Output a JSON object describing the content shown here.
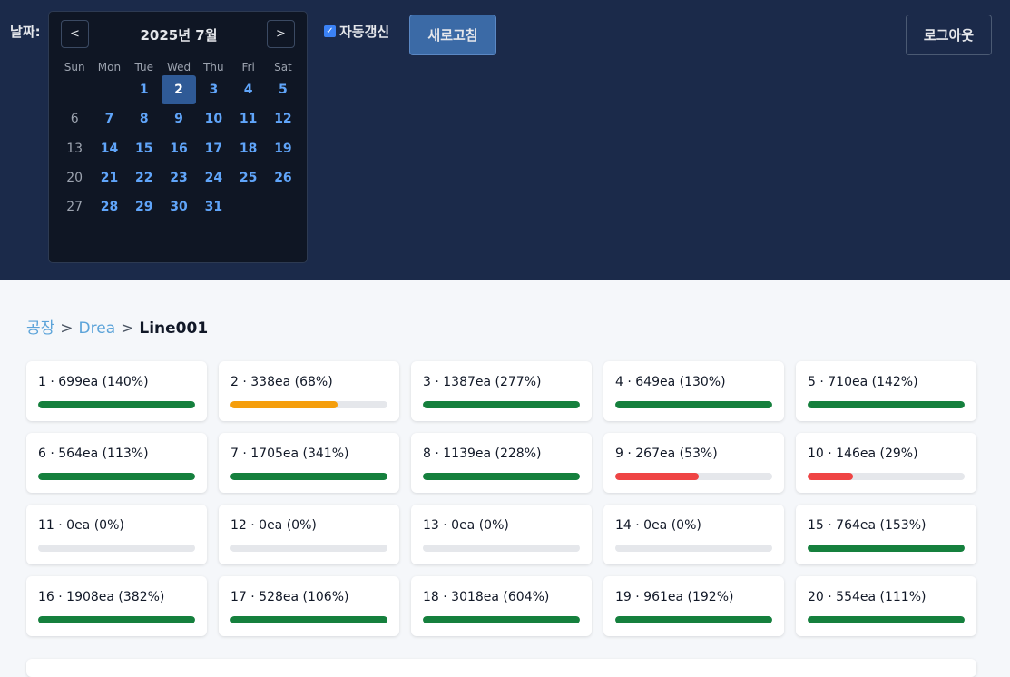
{
  "header": {
    "date_label": "날짜:",
    "auto_refresh_label": "자동갱신",
    "auto_refresh_checked": true,
    "refresh_button": "새로고침",
    "logout_button": "로그아웃"
  },
  "calendar": {
    "title": "2025년 7월",
    "prev": "<",
    "next": ">",
    "weekdays": [
      "Sun",
      "Mon",
      "Tue",
      "Wed",
      "Thu",
      "Fri",
      "Sat"
    ],
    "selected_day": "2",
    "weeks": [
      [
        "",
        "",
        "1",
        "2",
        "3",
        "4",
        "5"
      ],
      [
        "6",
        "7",
        "8",
        "9",
        "10",
        "11",
        "12"
      ],
      [
        "13",
        "14",
        "15",
        "16",
        "17",
        "18",
        "19"
      ],
      [
        "20",
        "21",
        "22",
        "23",
        "24",
        "25",
        "26"
      ],
      [
        "27",
        "28",
        "29",
        "30",
        "31",
        "",
        ""
      ]
    ]
  },
  "breadcrumb": {
    "items": [
      "공장",
      "Drea"
    ],
    "separator": ">",
    "current": "Line001"
  },
  "cards": [
    {
      "label": "1 · 699ea (140%)",
      "fill": 1.0,
      "status": "green"
    },
    {
      "label": "2 · 338ea (68%)",
      "fill": 0.68,
      "status": "orange"
    },
    {
      "label": "3 · 1387ea (277%)",
      "fill": 1.0,
      "status": "green"
    },
    {
      "label": "4 · 649ea (130%)",
      "fill": 1.0,
      "status": "green"
    },
    {
      "label": "5 · 710ea (142%)",
      "fill": 1.0,
      "status": "green"
    },
    {
      "label": "6 · 564ea (113%)",
      "fill": 1.0,
      "status": "green"
    },
    {
      "label": "7 · 1705ea (341%)",
      "fill": 1.0,
      "status": "green"
    },
    {
      "label": "8 · 1139ea (228%)",
      "fill": 1.0,
      "status": "green"
    },
    {
      "label": "9 · 267ea (53%)",
      "fill": 0.53,
      "status": "red"
    },
    {
      "label": "10 · 146ea (29%)",
      "fill": 0.29,
      "status": "red"
    },
    {
      "label": "11 · 0ea (0%)",
      "fill": 0,
      "status": "gray"
    },
    {
      "label": "12 · 0ea (0%)",
      "fill": 0,
      "status": "gray"
    },
    {
      "label": "13 · 0ea (0%)",
      "fill": 0,
      "status": "gray"
    },
    {
      "label": "14 · 0ea (0%)",
      "fill": 0,
      "status": "gray"
    },
    {
      "label": "15 · 764ea (153%)",
      "fill": 1.0,
      "status": "green"
    },
    {
      "label": "16 · 1908ea (382%)",
      "fill": 1.0,
      "status": "green"
    },
    {
      "label": "17 · 528ea (106%)",
      "fill": 1.0,
      "status": "green"
    },
    {
      "label": "18 · 3018ea (604%)",
      "fill": 1.0,
      "status": "green"
    },
    {
      "label": "19 · 961ea (192%)",
      "fill": 1.0,
      "status": "green"
    },
    {
      "label": "20 · 554ea (111%)",
      "fill": 1.0,
      "status": "green"
    }
  ],
  "colors": {
    "header_bg": "#1b2a4a",
    "calendar_bg": "#0f1624",
    "day_link": "#60a5fa",
    "selected_day_bg": "#2f5a96",
    "bar_green": "#15803d",
    "bar_orange": "#f59e0b",
    "bar_red": "#ef4444",
    "bar_track": "#e5e7eb"
  },
  "icons": {
    "checkbox": "checkbox-checked-icon"
  }
}
